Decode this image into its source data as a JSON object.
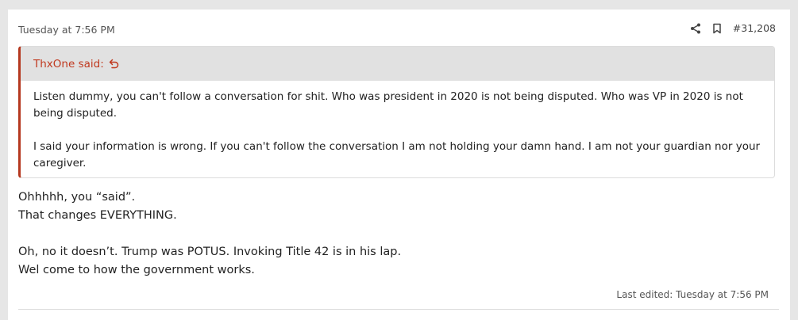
{
  "post": {
    "date": "Tuesday at 7:56 PM",
    "number": "#31,208",
    "icons": {
      "share": "share-icon",
      "bookmark": "bookmark-icon"
    }
  },
  "quote": {
    "author_said": "ThxOne said:",
    "jump_icon": "reply-jump-icon",
    "accent_color": "#b5381f",
    "paragraphs": [
      "Listen dummy, you can't follow a conversation for shit. Who was president in 2020 is not being disputed. Who was VP in 2020 is not being disputed.",
      "I said your information is wrong. If you can't follow the conversation I am not holding your damn hand. I am not your guardian nor your caregiver."
    ]
  },
  "message": {
    "lines": [
      "Ohhhhh, you “said”.",
      "That changes EVERYTHING.",
      "Oh, no it doesn’t. Trump was POTUS. Invoking Title 42 is in his lap.",
      "Wel come to how the government works."
    ]
  },
  "last_edited": "Last edited: Tuesday at 7:56 PM"
}
